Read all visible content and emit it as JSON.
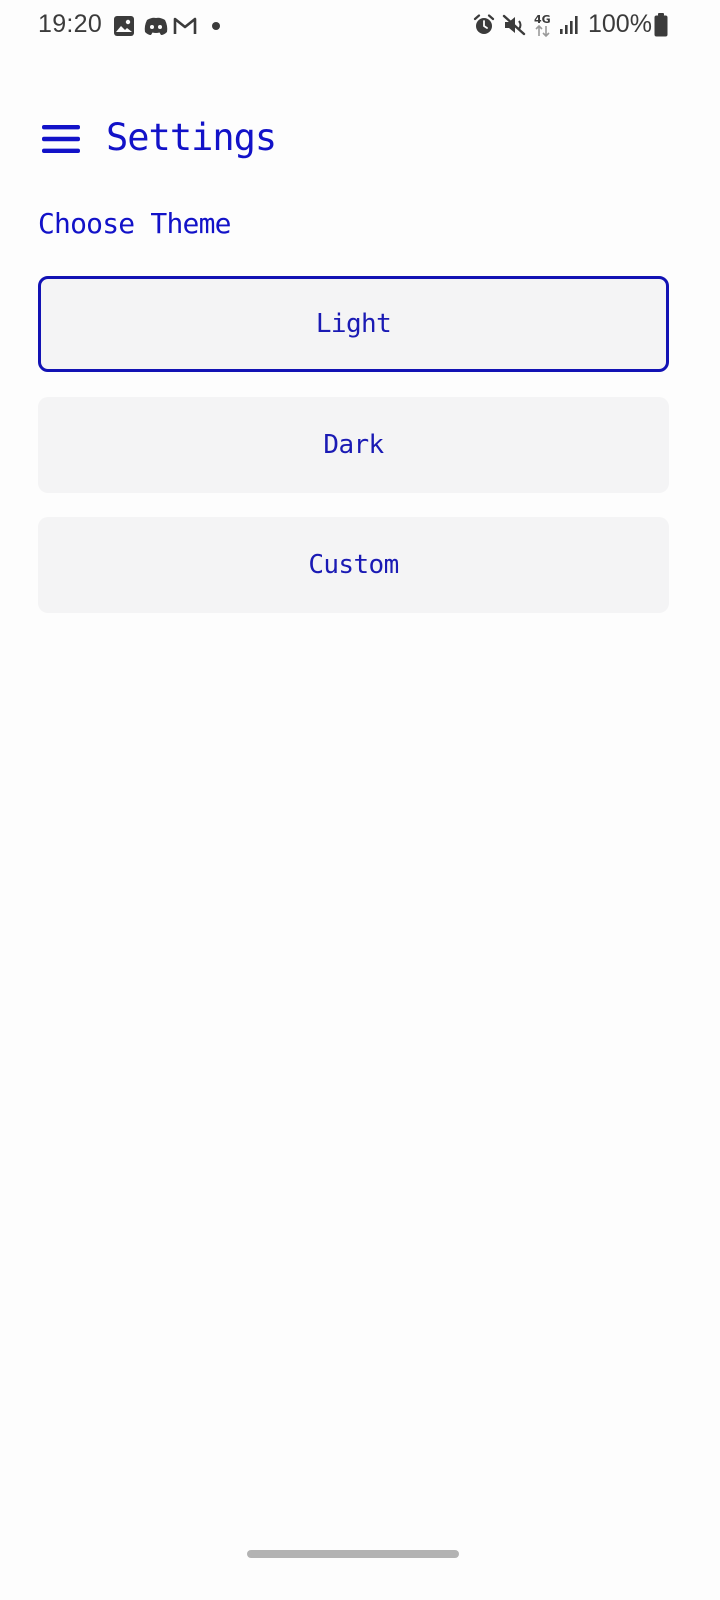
{
  "status_bar": {
    "time": "19:20",
    "battery_percent": "100%",
    "network_type": "4G",
    "left_icons": [
      "gallery-icon",
      "discord-icon",
      "gmail-icon",
      "dot-icon"
    ],
    "right_icons": [
      "alarm-icon",
      "mute-icon",
      "network-4g-icon",
      "signal-icon",
      "battery-icon"
    ]
  },
  "app_bar": {
    "title": "Settings",
    "menu_icon": "menu-icon"
  },
  "theme_section": {
    "label": "Choose Theme",
    "options": [
      {
        "label": "Light",
        "selected": true
      },
      {
        "label": "Dark",
        "selected": false
      },
      {
        "label": "Custom",
        "selected": false
      }
    ]
  },
  "colors": {
    "accent": "#1212c8",
    "option_background": "#f4f4f5",
    "page_background": "#fdfdfd"
  }
}
